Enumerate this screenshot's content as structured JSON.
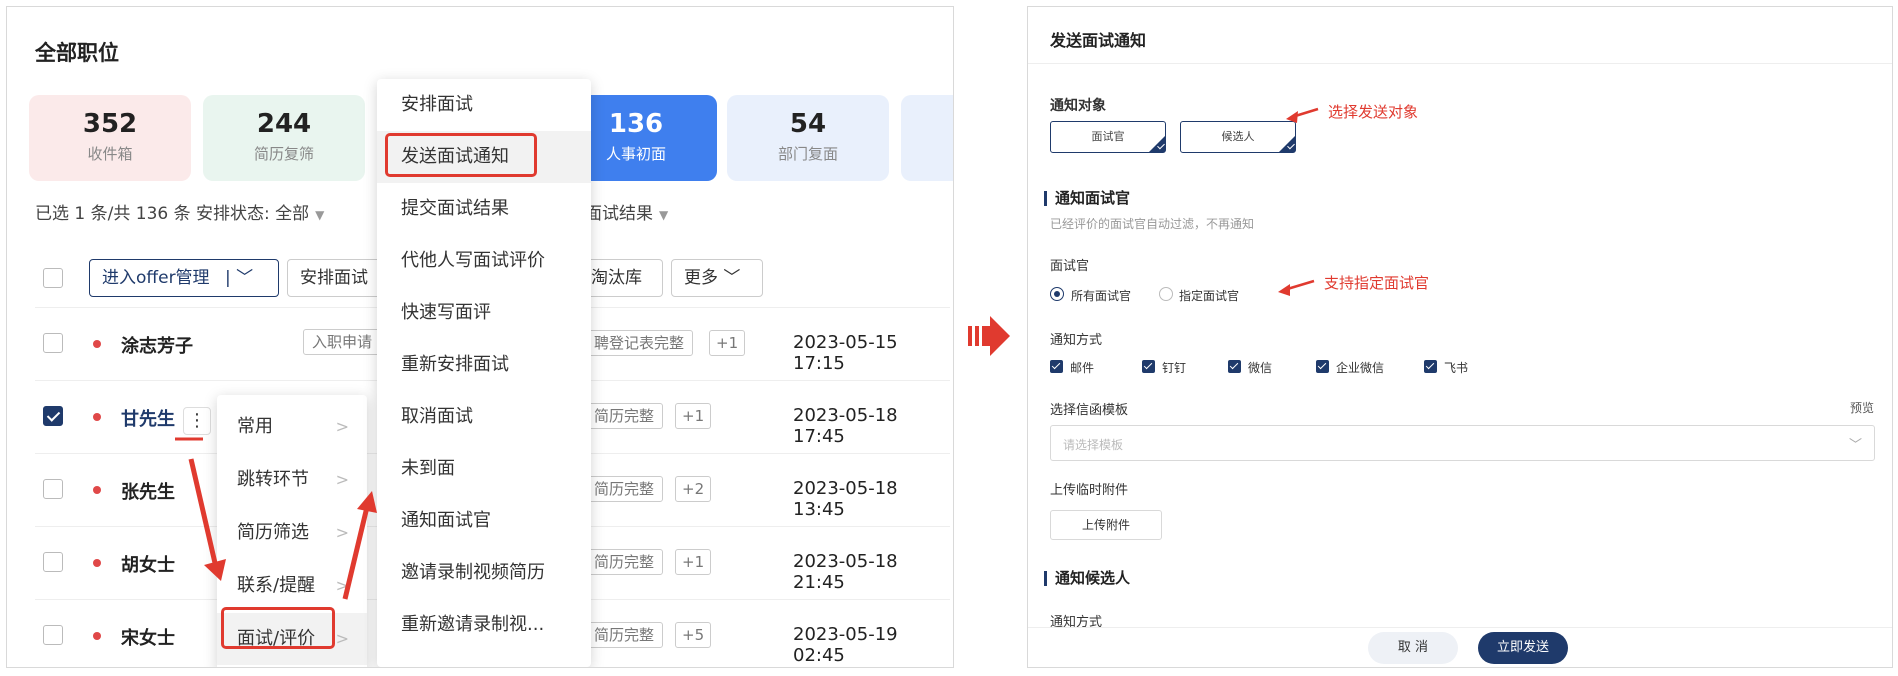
{
  "left": {
    "title": "全部职位",
    "stats": [
      {
        "num": "352",
        "label": "收件箱"
      },
      {
        "num": "244",
        "label": "简历复筛"
      },
      {
        "num": "136",
        "label": "人事初面"
      },
      {
        "num": "54",
        "label": "部门复面"
      }
    ],
    "filter": {
      "text": "已选 1 条/共 136 条  安排状态: 全部",
      "text2": "面试结果"
    },
    "toolbar": {
      "offer_label": "进入offer管理",
      "offer_chev": "|  ﹀",
      "arrange_label": "安排面试",
      "eliminate_label": "淘汰库",
      "more_label": "更多 ﹀"
    },
    "rows": [
      {
        "name": "涂志芳子",
        "tag": "聘登记表完整",
        "more": "+1",
        "time": "2023-05-15 17:15",
        "extra": "入职申请"
      },
      {
        "name": "甘先生",
        "tag": "简历完整",
        "more": "+1",
        "time": "2023-05-18 17:45"
      },
      {
        "name": "张先生",
        "tag": "简历完整",
        "more": "+2",
        "time": "2023-05-18 13:45"
      },
      {
        "name": "胡女士",
        "tag": "简历完整",
        "more": "+1",
        "time": "2023-05-18 21:45"
      },
      {
        "name": "宋女士",
        "tag": "简历完整",
        "more": "+5",
        "time": "2023-05-19 02:45"
      }
    ],
    "kebab": "⋮",
    "menu1": [
      {
        "label": "常用"
      },
      {
        "label": "跳转环节"
      },
      {
        "label": "简历筛选"
      },
      {
        "label": "联系/提醒"
      },
      {
        "label": "面试/评价"
      }
    ],
    "menu2": [
      {
        "label": "安排面试"
      },
      {
        "label": "发送面试通知"
      },
      {
        "label": "提交面试结果"
      },
      {
        "label": "代他人写面试评价"
      },
      {
        "label": "快速写面评"
      },
      {
        "label": "重新安排面试"
      },
      {
        "label": "取消面试"
      },
      {
        "label": "未到面"
      },
      {
        "label": "通知面试官"
      },
      {
        "label": "邀请录制视频简历"
      },
      {
        "label": "重新邀请录制视..."
      }
    ]
  },
  "right": {
    "title": "发送面试通知",
    "notify_target_label": "通知对象",
    "targets": [
      "面试官",
      "候选人"
    ],
    "annot_target": "选择发送对象",
    "section_interviewer": "通知面试官",
    "interviewer_hint": "已经评价的面试官自动过滤，不再通知",
    "interviewer_label": "面试官",
    "radio_all": "所有面试官",
    "radio_specific": "指定面试官",
    "annot_specific": "支持指定面试官",
    "method_label": "通知方式",
    "methods": [
      "邮件",
      "钉钉",
      "微信",
      "企业微信",
      "飞书"
    ],
    "template_label": "选择信函模板",
    "preview": "预览",
    "template_placeholder": "请选择模板",
    "template_chev": "﹀",
    "attach_label": "上传临时附件",
    "attach_button": "上传附件",
    "section_candidate": "通知候选人",
    "candidate_method_label": "通知方式",
    "cancel": "取 消",
    "send": "立即发送"
  },
  "colors": {
    "accent": "#1f3a6b",
    "annotation": "#e03a2f",
    "stat_active": "#3f7fee"
  }
}
